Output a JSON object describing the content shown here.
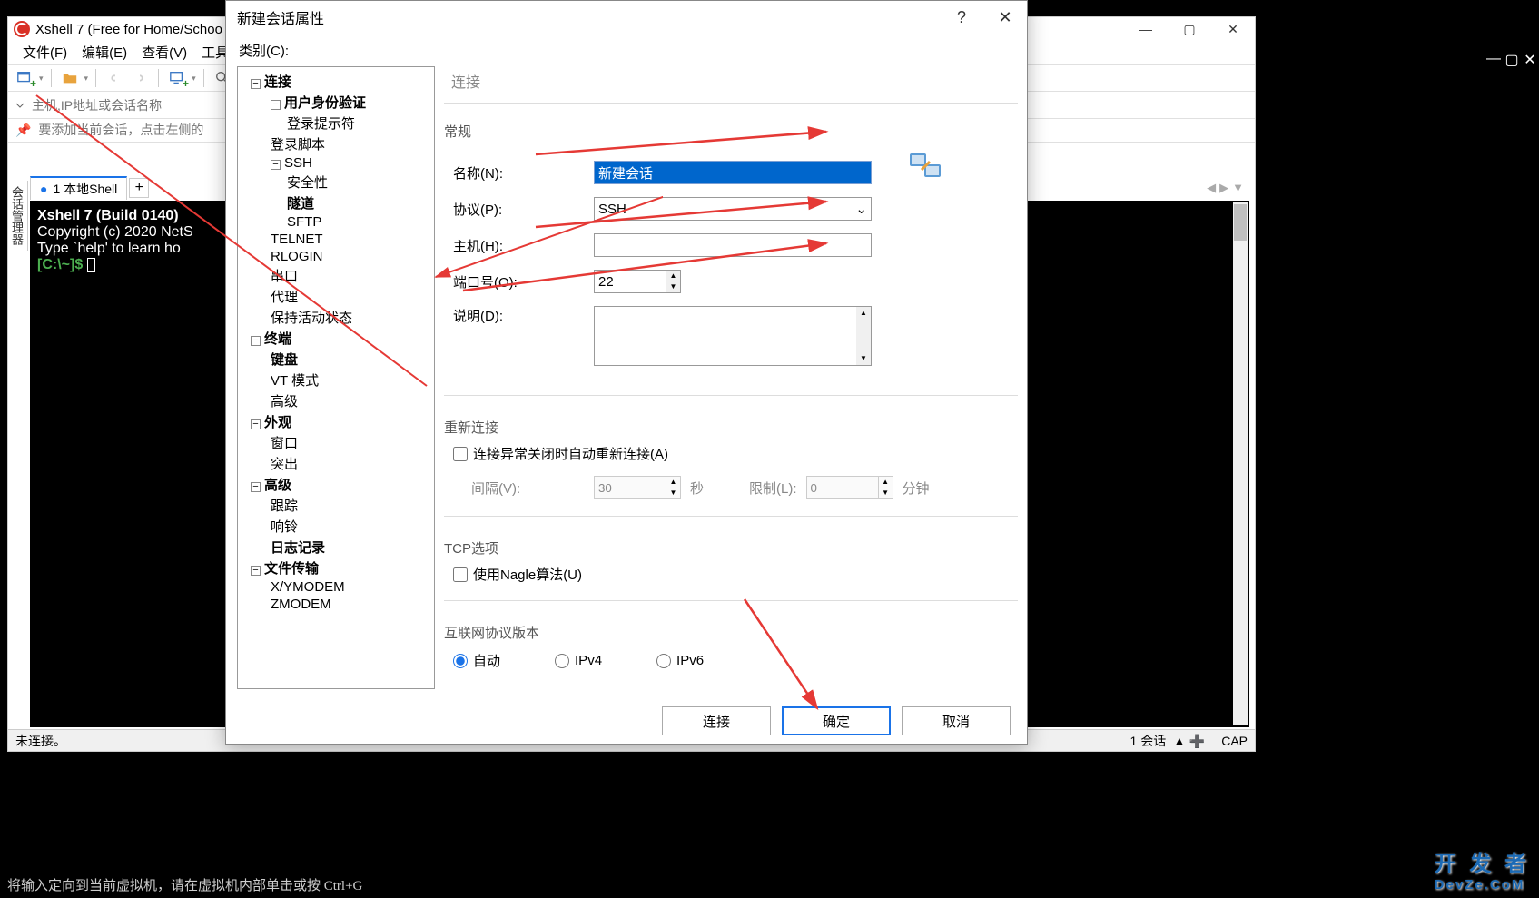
{
  "mainWindow": {
    "title": "Xshell 7 (Free for Home/Schoo",
    "menu": [
      "文件(F)",
      "编辑(E)",
      "查看(V)",
      "工具("
    ],
    "address_placeholder": "主机,IP地址或会话名称",
    "hint": "要添加当前会话，点击左侧的",
    "tab_label": "1 本地Shell",
    "terminal_lines": [
      "Xshell 7 (Build 0140)",
      "Copyright (c) 2020 NetS",
      "",
      "Type `help' to learn ho"
    ],
    "prompt": "[C:\\~]$ ",
    "sidebar_label": "会话管理器",
    "status_left": "未连接。",
    "status_sessions": "1 会话",
    "status_cap": "CAP"
  },
  "dialog": {
    "title": "新建会话属性",
    "category_label": "类别(C):",
    "tree": [
      {
        "label": "连接",
        "level": 1,
        "toggle": "−",
        "bold": true
      },
      {
        "label": "用户身份验证",
        "level": 2,
        "toggle": "−",
        "bold": true
      },
      {
        "label": "登录提示符",
        "level": 3
      },
      {
        "label": "登录脚本",
        "level": 2
      },
      {
        "label": "SSH",
        "level": 2,
        "toggle": "−"
      },
      {
        "label": "安全性",
        "level": 3
      },
      {
        "label": "隧道",
        "level": 3,
        "bold": true
      },
      {
        "label": "SFTP",
        "level": 3
      },
      {
        "label": "TELNET",
        "level": 2
      },
      {
        "label": "RLOGIN",
        "level": 2
      },
      {
        "label": "串口",
        "level": 2
      },
      {
        "label": "代理",
        "level": 2
      },
      {
        "label": "保持活动状态",
        "level": 2
      },
      {
        "label": "终端",
        "level": 1,
        "toggle": "−",
        "bold": true
      },
      {
        "label": "键盘",
        "level": 2,
        "bold": true
      },
      {
        "label": "VT 模式",
        "level": 2
      },
      {
        "label": "高级",
        "level": 2
      },
      {
        "label": "外观",
        "level": 1,
        "toggle": "−",
        "bold": true
      },
      {
        "label": "窗口",
        "level": 2
      },
      {
        "label": "突出",
        "level": 2
      },
      {
        "label": "高级",
        "level": 1,
        "toggle": "−",
        "bold": true
      },
      {
        "label": "跟踪",
        "level": 2
      },
      {
        "label": "响铃",
        "level": 2
      },
      {
        "label": "日志记录",
        "level": 2,
        "bold": true
      },
      {
        "label": "文件传输",
        "level": 1,
        "toggle": "−",
        "bold": true
      },
      {
        "label": "X/YMODEM",
        "level": 2
      },
      {
        "label": "ZMODEM",
        "level": 2
      }
    ],
    "pane_title": "连接",
    "group_general": "常规",
    "label_name": "名称(N):",
    "value_name": "新建会话",
    "label_protocol": "协议(P):",
    "value_protocol": "SSH",
    "label_host": "主机(H):",
    "value_host": "",
    "label_port": "端口号(O):",
    "value_port": "22",
    "label_desc": "说明(D):",
    "group_reconnect": "重新连接",
    "reconnect_check": "连接异常关闭时自动重新连接(A)",
    "label_interval": "间隔(V):",
    "value_interval": "30",
    "unit_sec": "秒",
    "label_limit": "限制(L):",
    "value_limit": "0",
    "unit_min": "分钟",
    "group_tcp": "TCP选项",
    "nagle_check": "使用Nagle算法(U)",
    "group_ip": "互联网协议版本",
    "radio_auto": "自动",
    "radio_ipv4": "IPv4",
    "radio_ipv6": "IPv6",
    "btn_connect": "连接",
    "btn_ok": "确定",
    "btn_cancel": "取消"
  },
  "watermark": {
    "line1": "开 发 者",
    "line2": "DevZe.CoM"
  },
  "bottom_text": "将输入定向到当前虚拟机，请在虚拟机内部单击或按 Ctrl+G"
}
